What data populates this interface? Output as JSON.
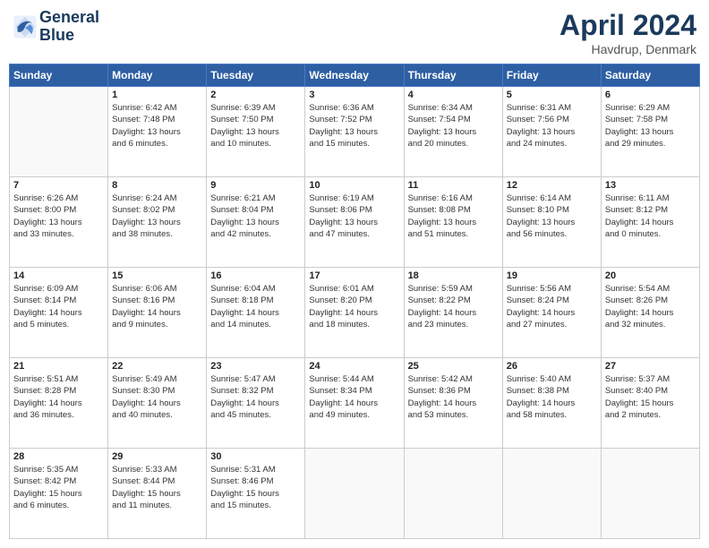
{
  "logo": {
    "line1": "General",
    "line2": "Blue"
  },
  "title": "April 2024",
  "subtitle": "Havdrup, Denmark",
  "weekdays": [
    "Sunday",
    "Monday",
    "Tuesday",
    "Wednesday",
    "Thursday",
    "Friday",
    "Saturday"
  ],
  "weeks": [
    [
      {
        "day": "",
        "info": ""
      },
      {
        "day": "1",
        "info": "Sunrise: 6:42 AM\nSunset: 7:48 PM\nDaylight: 13 hours\nand 6 minutes."
      },
      {
        "day": "2",
        "info": "Sunrise: 6:39 AM\nSunset: 7:50 PM\nDaylight: 13 hours\nand 10 minutes."
      },
      {
        "day": "3",
        "info": "Sunrise: 6:36 AM\nSunset: 7:52 PM\nDaylight: 13 hours\nand 15 minutes."
      },
      {
        "day": "4",
        "info": "Sunrise: 6:34 AM\nSunset: 7:54 PM\nDaylight: 13 hours\nand 20 minutes."
      },
      {
        "day": "5",
        "info": "Sunrise: 6:31 AM\nSunset: 7:56 PM\nDaylight: 13 hours\nand 24 minutes."
      },
      {
        "day": "6",
        "info": "Sunrise: 6:29 AM\nSunset: 7:58 PM\nDaylight: 13 hours\nand 29 minutes."
      }
    ],
    [
      {
        "day": "7",
        "info": "Sunrise: 6:26 AM\nSunset: 8:00 PM\nDaylight: 13 hours\nand 33 minutes."
      },
      {
        "day": "8",
        "info": "Sunrise: 6:24 AM\nSunset: 8:02 PM\nDaylight: 13 hours\nand 38 minutes."
      },
      {
        "day": "9",
        "info": "Sunrise: 6:21 AM\nSunset: 8:04 PM\nDaylight: 13 hours\nand 42 minutes."
      },
      {
        "day": "10",
        "info": "Sunrise: 6:19 AM\nSunset: 8:06 PM\nDaylight: 13 hours\nand 47 minutes."
      },
      {
        "day": "11",
        "info": "Sunrise: 6:16 AM\nSunset: 8:08 PM\nDaylight: 13 hours\nand 51 minutes."
      },
      {
        "day": "12",
        "info": "Sunrise: 6:14 AM\nSunset: 8:10 PM\nDaylight: 13 hours\nand 56 minutes."
      },
      {
        "day": "13",
        "info": "Sunrise: 6:11 AM\nSunset: 8:12 PM\nDaylight: 14 hours\nand 0 minutes."
      }
    ],
    [
      {
        "day": "14",
        "info": "Sunrise: 6:09 AM\nSunset: 8:14 PM\nDaylight: 14 hours\nand 5 minutes."
      },
      {
        "day": "15",
        "info": "Sunrise: 6:06 AM\nSunset: 8:16 PM\nDaylight: 14 hours\nand 9 minutes."
      },
      {
        "day": "16",
        "info": "Sunrise: 6:04 AM\nSunset: 8:18 PM\nDaylight: 14 hours\nand 14 minutes."
      },
      {
        "day": "17",
        "info": "Sunrise: 6:01 AM\nSunset: 8:20 PM\nDaylight: 14 hours\nand 18 minutes."
      },
      {
        "day": "18",
        "info": "Sunrise: 5:59 AM\nSunset: 8:22 PM\nDaylight: 14 hours\nand 23 minutes."
      },
      {
        "day": "19",
        "info": "Sunrise: 5:56 AM\nSunset: 8:24 PM\nDaylight: 14 hours\nand 27 minutes."
      },
      {
        "day": "20",
        "info": "Sunrise: 5:54 AM\nSunset: 8:26 PM\nDaylight: 14 hours\nand 32 minutes."
      }
    ],
    [
      {
        "day": "21",
        "info": "Sunrise: 5:51 AM\nSunset: 8:28 PM\nDaylight: 14 hours\nand 36 minutes."
      },
      {
        "day": "22",
        "info": "Sunrise: 5:49 AM\nSunset: 8:30 PM\nDaylight: 14 hours\nand 40 minutes."
      },
      {
        "day": "23",
        "info": "Sunrise: 5:47 AM\nSunset: 8:32 PM\nDaylight: 14 hours\nand 45 minutes."
      },
      {
        "day": "24",
        "info": "Sunrise: 5:44 AM\nSunset: 8:34 PM\nDaylight: 14 hours\nand 49 minutes."
      },
      {
        "day": "25",
        "info": "Sunrise: 5:42 AM\nSunset: 8:36 PM\nDaylight: 14 hours\nand 53 minutes."
      },
      {
        "day": "26",
        "info": "Sunrise: 5:40 AM\nSunset: 8:38 PM\nDaylight: 14 hours\nand 58 minutes."
      },
      {
        "day": "27",
        "info": "Sunrise: 5:37 AM\nSunset: 8:40 PM\nDaylight: 15 hours\nand 2 minutes."
      }
    ],
    [
      {
        "day": "28",
        "info": "Sunrise: 5:35 AM\nSunset: 8:42 PM\nDaylight: 15 hours\nand 6 minutes."
      },
      {
        "day": "29",
        "info": "Sunrise: 5:33 AM\nSunset: 8:44 PM\nDaylight: 15 hours\nand 11 minutes."
      },
      {
        "day": "30",
        "info": "Sunrise: 5:31 AM\nSunset: 8:46 PM\nDaylight: 15 hours\nand 15 minutes."
      },
      {
        "day": "",
        "info": ""
      },
      {
        "day": "",
        "info": ""
      },
      {
        "day": "",
        "info": ""
      },
      {
        "day": "",
        "info": ""
      }
    ]
  ]
}
